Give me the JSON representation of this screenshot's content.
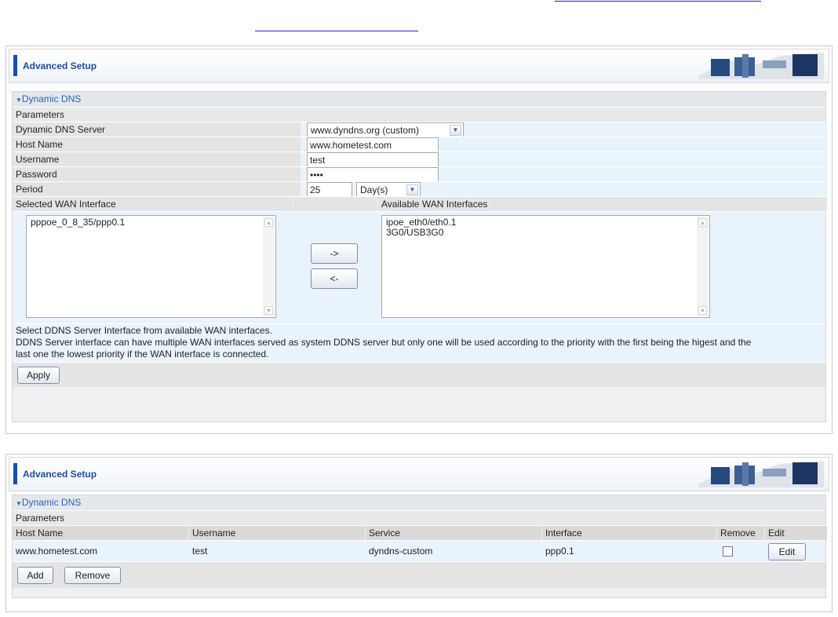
{
  "panel1": {
    "header_title": "Advanced Setup",
    "section_title": "Dynamic DNS",
    "parameters_label": "Parameters",
    "fields": {
      "server_label": "Dynamic DNS Server",
      "server_value": "www.dyndns.org (custom)",
      "hostname_label": "Host Name",
      "hostname_value": "www.hometest.com",
      "username_label": "Username",
      "username_value": "test",
      "password_label": "Password",
      "password_value": "••••",
      "period_label": "Period",
      "period_value": "25",
      "period_unit": "Day(s)"
    },
    "selected_wan_label": "Selected WAN Interface",
    "available_wan_label": "Available WAN Interfaces",
    "selected_wan_items": [
      "pppoe_0_8_35/ppp0.1"
    ],
    "available_wan_items": [
      "ipoe_eth0/eth0.1",
      "3G0/USB3G0"
    ],
    "move_right_label": "->",
    "move_left_label": "<-",
    "help_line1": "Select DDNS Server Interface from available WAN interfaces.",
    "help_line2": "DDNS Server interface can have multiple WAN interfaces served as system DDNS server but only one will be used according to the priority with the first being the higest and the",
    "help_line3": "last one the lowest priority if the WAN interface is connected.",
    "apply_label": "Apply"
  },
  "panel2": {
    "header_title": "Advanced Setup",
    "section_title": "Dynamic DNS",
    "parameters_label": "Parameters",
    "columns": [
      "Host Name",
      "Username",
      "Service",
      "Interface",
      "Remove",
      "Edit"
    ],
    "rows": [
      {
        "host": "www.hometest.com",
        "username": "test",
        "service": "dyndns-custom",
        "interface": "ppp0.1",
        "remove_checked": false,
        "edit_label": "Edit"
      }
    ],
    "add_label": "Add",
    "remove_label": "Remove"
  },
  "colors": {
    "accent": "#1a4fa8",
    "section_title": "#2a63b1",
    "link": "#1f1fd0"
  }
}
